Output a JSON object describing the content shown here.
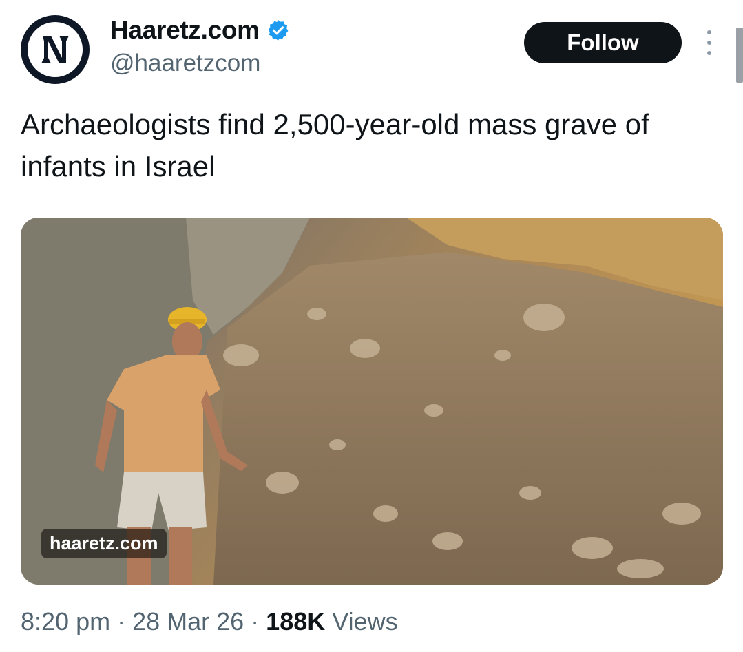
{
  "account": {
    "name": "Haaretz.com",
    "handle": "@haaretzcom",
    "verified": true,
    "verified_color": "#1d9bf0",
    "avatar_icon": "haaretz-logo-icon"
  },
  "follow_button": {
    "label": "Follow"
  },
  "more_icon": "more-vertical-icon",
  "tweet": {
    "text": "Archaeologists find 2,500-year-old mass grave of infants in Israel"
  },
  "media": {
    "source_label": "haaretz.com"
  },
  "meta": {
    "time": "8:20 pm",
    "date": "28 Mar 26",
    "separator": "·",
    "views_count": "188K",
    "views_label": "Views"
  },
  "colors": {
    "text_primary": "#0f1419",
    "text_secondary": "#536471",
    "button_bg": "#0f1419"
  }
}
